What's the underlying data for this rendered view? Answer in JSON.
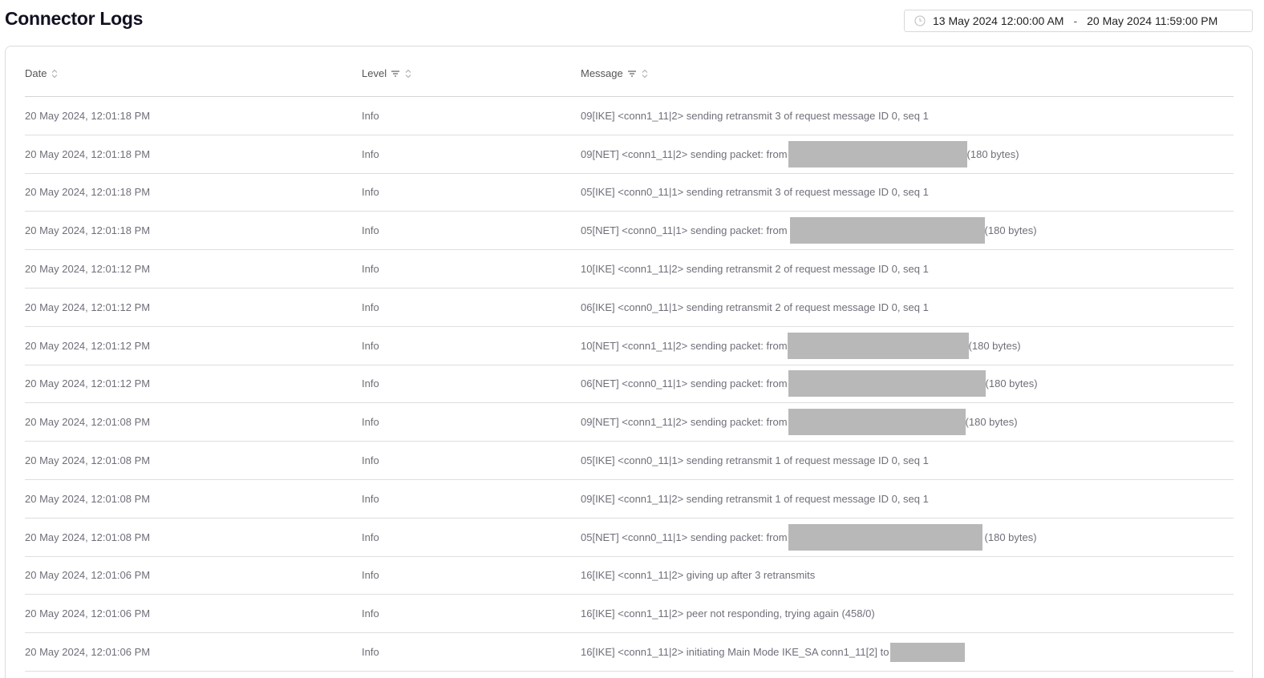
{
  "page": {
    "title": "Connector Logs"
  },
  "date_range": {
    "from": "13 May 2024 12:00:00 AM",
    "separator": "-",
    "to": "20 May 2024 11:59:00 PM",
    "icon": "clock-icon"
  },
  "table": {
    "columns": {
      "date": "Date",
      "level": "Level",
      "message": "Message"
    },
    "rows": [
      {
        "date": "20 May 2024, 12:01:18 PM",
        "level": "Info",
        "message": "09[IKE] <conn1_11|2> sending retransmit 3 of request message ID 0, seq 1",
        "suffix": ""
      },
      {
        "date": "20 May 2024, 12:01:18 PM",
        "level": "Info",
        "message": "09[NET] <conn1_11|2> sending packet: from",
        "suffix": "(180 bytes)"
      },
      {
        "date": "20 May 2024, 12:01:18 PM",
        "level": "Info",
        "message": "05[IKE] <conn0_11|1> sending retransmit 3 of request message ID 0, seq 1",
        "suffix": ""
      },
      {
        "date": "20 May 2024, 12:01:18 PM",
        "level": "Info",
        "message": "05[NET] <conn0_11|1> sending packet: from",
        "suffix": "(180 bytes)"
      },
      {
        "date": "20 May 2024, 12:01:12 PM",
        "level": "Info",
        "message": "10[IKE] <conn1_11|2> sending retransmit 2 of request message ID 0, seq 1",
        "suffix": ""
      },
      {
        "date": "20 May 2024, 12:01:12 PM",
        "level": "Info",
        "message": "06[IKE] <conn0_11|1> sending retransmit 2 of request message ID 0, seq 1",
        "suffix": ""
      },
      {
        "date": "20 May 2024, 12:01:12 PM",
        "level": "Info",
        "message": "10[NET] <conn1_11|2> sending packet: from",
        "suffix": "(180 bytes)"
      },
      {
        "date": "20 May 2024, 12:01:12 PM",
        "level": "Info",
        "message": "06[NET] <conn0_11|1> sending packet: from",
        "suffix": "(180 bytes)"
      },
      {
        "date": "20 May 2024, 12:01:08 PM",
        "level": "Info",
        "message": "09[NET] <conn1_11|2> sending packet: from",
        "suffix": "(180 bytes)"
      },
      {
        "date": "20 May 2024, 12:01:08 PM",
        "level": "Info",
        "message": "05[IKE] <conn0_11|1> sending retransmit 1 of request message ID 0, seq 1",
        "suffix": ""
      },
      {
        "date": "20 May 2024, 12:01:08 PM",
        "level": "Info",
        "message": "09[IKE] <conn1_11|2> sending retransmit 1 of request message ID 0, seq 1",
        "suffix": ""
      },
      {
        "date": "20 May 2024, 12:01:08 PM",
        "level": "Info",
        "message": "05[NET] <conn0_11|1> sending packet: from",
        "suffix": "(180 bytes)"
      },
      {
        "date": "20 May 2024, 12:01:06 PM",
        "level": "Info",
        "message": "16[IKE] <conn1_11|2> giving up after 3 retransmits",
        "suffix": ""
      },
      {
        "date": "20 May 2024, 12:01:06 PM",
        "level": "Info",
        "message": "16[IKE] <conn1_11|2> peer not responding, trying again (458/0)",
        "suffix": ""
      },
      {
        "date": "20 May 2024, 12:01:06 PM",
        "level": "Info",
        "message": "16[IKE] <conn1_11|2> initiating Main Mode IKE_SA conn1_11[2] to",
        "suffix": ""
      }
    ]
  }
}
